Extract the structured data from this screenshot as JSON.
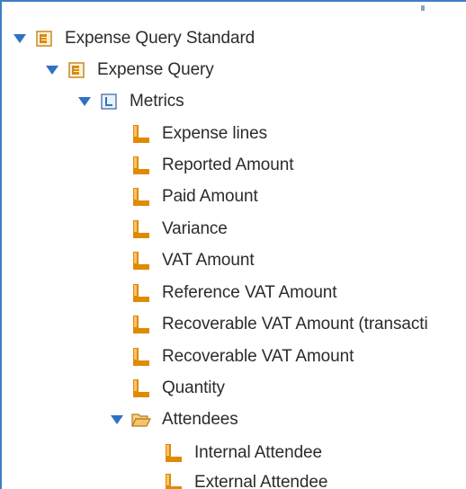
{
  "tree": {
    "root": {
      "label": "Expense Query Standard",
      "icon": "query-subject-icon",
      "expanded": true
    },
    "query": {
      "label": "Expense Query",
      "icon": "query-subject-icon",
      "expanded": true
    },
    "metrics": {
      "label": "Metrics",
      "icon": "measure-dimension-icon",
      "expanded": true,
      "items": [
        {
          "label": "Expense lines",
          "icon": "measure-icon"
        },
        {
          "label": "Reported Amount",
          "icon": "measure-icon"
        },
        {
          "label": "Paid Amount",
          "icon": "measure-icon"
        },
        {
          "label": "Variance",
          "icon": "measure-icon"
        },
        {
          "label": "VAT Amount",
          "icon": "measure-icon"
        },
        {
          "label": "Reference VAT Amount",
          "icon": "measure-icon"
        },
        {
          "label": "Recoverable VAT Amount (transacti",
          "icon": "measure-icon"
        },
        {
          "label": "Recoverable VAT Amount",
          "icon": "measure-icon"
        },
        {
          "label": "Quantity",
          "icon": "measure-icon"
        }
      ]
    },
    "attendees": {
      "label": "Attendees",
      "icon": "folder-open-icon",
      "expanded": true,
      "items": [
        {
          "label": "Internal Attendee",
          "icon": "measure-icon"
        },
        {
          "label": "External Attendee",
          "icon": "measure-icon"
        }
      ]
    }
  },
  "colors": {
    "twisty": "#2f72c4",
    "measure_icon": "#e08a00",
    "measure_icon_light": "#f6c46a",
    "frame_border": "#3f7ec4",
    "text": "#2b2b2b"
  }
}
